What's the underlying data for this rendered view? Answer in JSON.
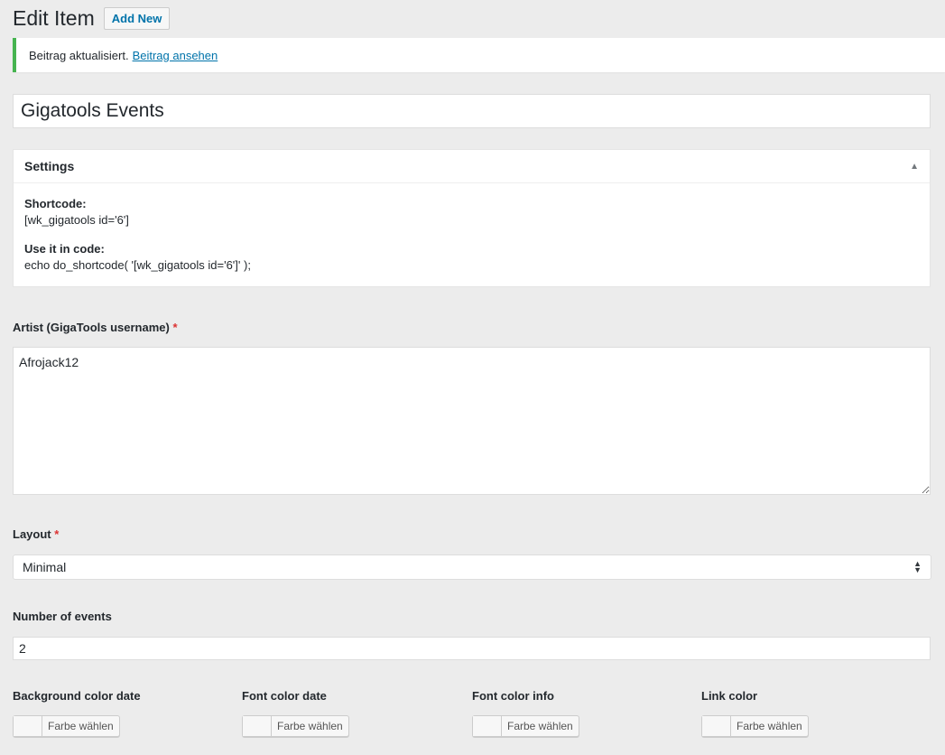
{
  "header": {
    "title": "Edit Item",
    "add_new_label": "Add New"
  },
  "notice": {
    "text": "Beitrag aktualisiert.",
    "link_text": "Beitrag ansehen"
  },
  "post_title": {
    "value": "Gigatools Events"
  },
  "settings_box": {
    "title": "Settings",
    "shortcode_label": "Shortcode:",
    "shortcode_value": "[wk_gigatools id='6']",
    "code_label": "Use it in code:",
    "code_value": "echo do_shortcode( '[wk_gigatools id='6']' );"
  },
  "fields": {
    "artist": {
      "label": "Artist (GigaTools username)",
      "required_mark": "*",
      "value": "Afrojack12"
    },
    "layout": {
      "label": "Layout",
      "required_mark": "*",
      "selected": "Minimal"
    },
    "num_events": {
      "label": "Number of events",
      "value": "2"
    }
  },
  "color_fields": [
    {
      "label": "Background color date",
      "button_label": "Farbe wählen"
    },
    {
      "label": "Font color date",
      "button_label": "Farbe wählen"
    },
    {
      "label": "Font color info",
      "button_label": "Farbe wählen"
    },
    {
      "label": "Link color",
      "button_label": "Farbe wählen"
    }
  ],
  "colors": {
    "accent": "#0073aa",
    "success": "#46b450",
    "required": "#dc3232",
    "background": "#ececec"
  }
}
